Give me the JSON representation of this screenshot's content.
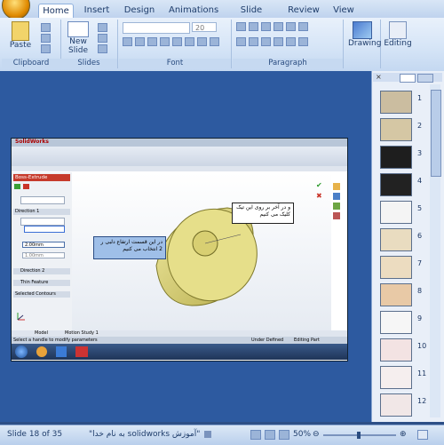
{
  "ribbon": {
    "tabs": [
      "Home",
      "Insert",
      "Design",
      "Animations",
      "Slide Show",
      "Review",
      "View"
    ],
    "groups": {
      "clipboard": {
        "label": "Clipboard",
        "paste": "Paste"
      },
      "slides": {
        "label": "Slides",
        "new_slide": "New Slide"
      },
      "font": {
        "label": "Font",
        "size_value": "20"
      },
      "paragraph": {
        "label": "Paragraph"
      },
      "drawing": {
        "label": "Drawing"
      },
      "editing": {
        "label": "Editing"
      }
    }
  },
  "slide": {
    "solidworks": {
      "title_logo": "SolidWorks",
      "feature_title": "Boss-Extrude",
      "section_direction": "Direction 1",
      "depth_value": "2.00mm",
      "value2": "1.00mm",
      "section_direction2": "Direction 2",
      "section_thin": "Thin Feature",
      "section_contours": "Selected Contours",
      "tab_model": "Model",
      "tab_motion": "Motion Study 1",
      "status_left": "Select a handle to modify parameters",
      "status_mid": "Under Defined",
      "status_right": "Editing Part"
    },
    "callout_right": "و در آخر بر روی این تیک کلیک می کنیم",
    "callout_left": "در این قسمت ارتفاع دلبی ر 2 انتخاب می کنیم"
  },
  "panel": {
    "slide_numbers": [
      "1",
      "2",
      "3",
      "4",
      "5",
      "6",
      "7",
      "8",
      "9",
      "10",
      "11",
      "12"
    ]
  },
  "status": {
    "slide_info": "Slide 18 of 35",
    "theme": "\"به نام خدا solidworks آموزش\"",
    "zoom": "50%"
  }
}
